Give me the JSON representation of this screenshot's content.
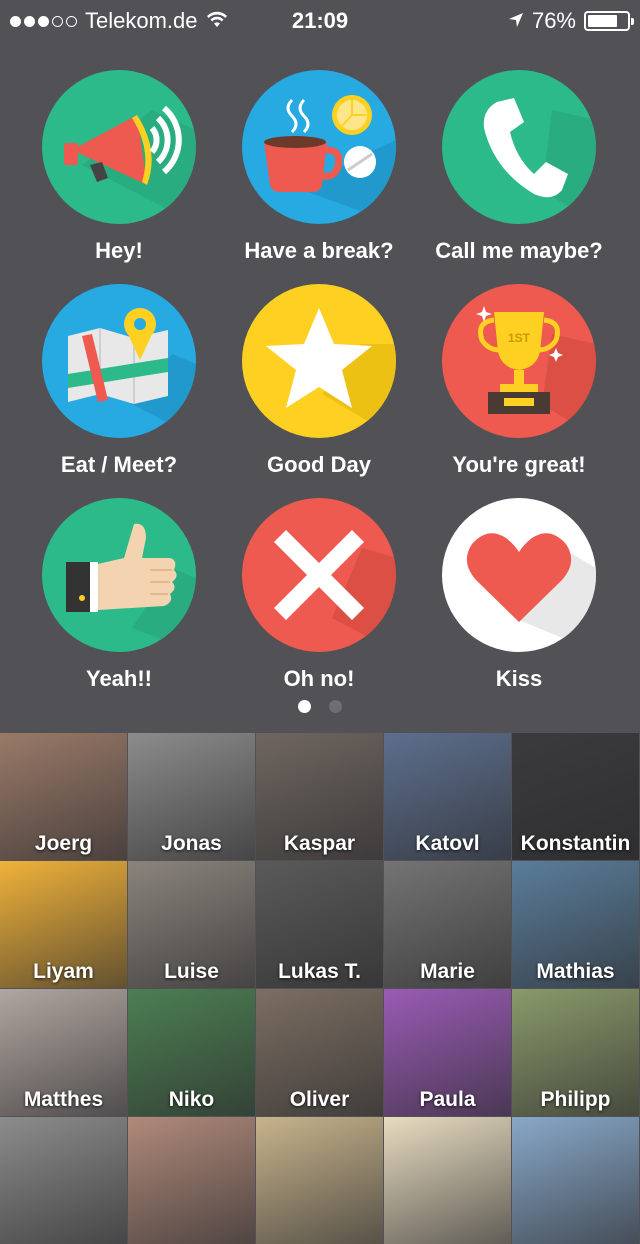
{
  "status_bar": {
    "carrier": "Telekom.de",
    "time": "21:09",
    "battery": "76%",
    "battery_level": 0.76,
    "signal_bars_filled": 3,
    "signal_bars_total": 5
  },
  "actions": [
    {
      "label": "Hey!",
      "icon": "megaphone-icon",
      "color": "#2dba8a"
    },
    {
      "label": "Have a break?",
      "icon": "coffee-break-icon",
      "color": "#27a9e1"
    },
    {
      "label": "Call me maybe?",
      "icon": "phone-icon",
      "color": "#2dba8a"
    },
    {
      "label": "Eat / Meet?",
      "icon": "map-pin-icon",
      "color": "#27a9e1"
    },
    {
      "label": "Good Day",
      "icon": "star-icon",
      "color": "#fdd021"
    },
    {
      "label": "You're great!",
      "icon": "trophy-icon",
      "color": "#ee5a4f"
    },
    {
      "label": "Yeah!!",
      "icon": "thumbs-up-icon",
      "color": "#2dba8a"
    },
    {
      "label": "Oh no!",
      "icon": "cross-icon",
      "color": "#ee5a4f"
    },
    {
      "label": "Kiss",
      "icon": "heart-icon",
      "color": "#ffffff"
    }
  ],
  "pager": {
    "pages": 2,
    "active": 0
  },
  "contacts": [
    {
      "name": "Joerg",
      "color": "#9a7a68"
    },
    {
      "name": "Jonas",
      "color": "#8c8c8c"
    },
    {
      "name": "Kaspar",
      "color": "#6f6660"
    },
    {
      "name": "Katovl",
      "color": "#5d6f8d"
    },
    {
      "name": "Konstantin",
      "color": "#3b3b3d"
    },
    {
      "name": "Liyam",
      "color": "#f0b23a"
    },
    {
      "name": "Luise",
      "color": "#8a847c"
    },
    {
      "name": "Lukas T.",
      "color": "#5a5a5a"
    },
    {
      "name": "Marie",
      "color": "#747474"
    },
    {
      "name": "Mathias",
      "color": "#5a7d9a"
    },
    {
      "name": "Matthes",
      "color": "#b1a6a0"
    },
    {
      "name": "Niko",
      "color": "#4c7f52"
    },
    {
      "name": "Oliver",
      "color": "#7c6e62"
    },
    {
      "name": "Paula",
      "color": "#9a5bb5"
    },
    {
      "name": "Philipp",
      "color": "#8a9a6a"
    },
    {
      "name": "",
      "color": "#8c8c8c"
    },
    {
      "name": "",
      "color": "#b08a7a"
    },
    {
      "name": "",
      "color": "#c8b48c"
    },
    {
      "name": "",
      "color": "#e8dcc0"
    },
    {
      "name": "",
      "color": "#88a8c8"
    }
  ]
}
